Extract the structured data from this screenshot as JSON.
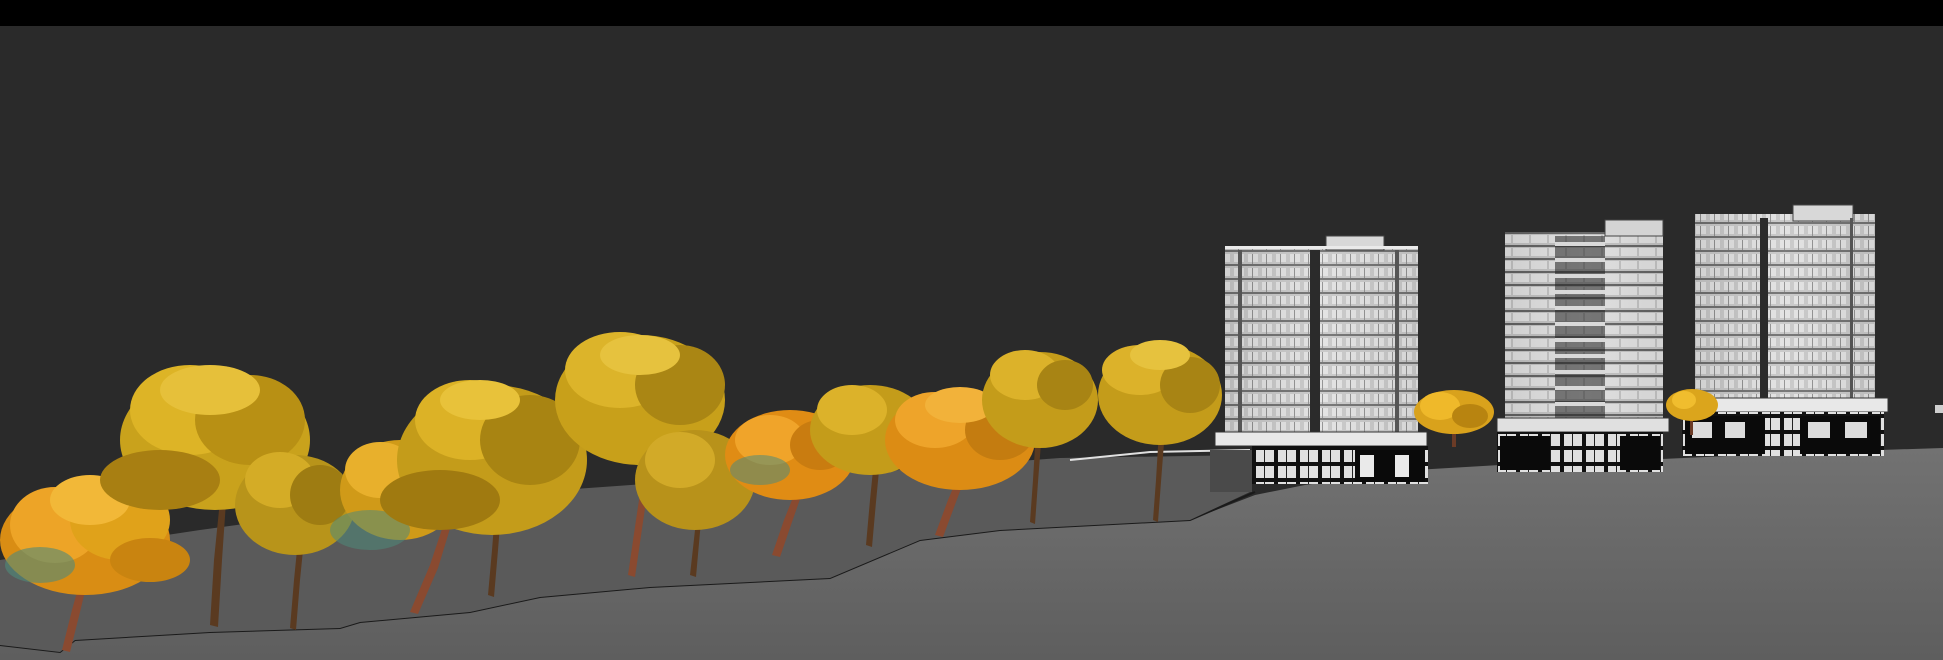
{
  "scene": {
    "colors": {
      "top_bar": "#000000",
      "sky": "#2a2a2a",
      "ground": "#6a6a6a",
      "terrace": "#595959",
      "building_face": "#c4c4c4",
      "building_shadow": "#3c3c3c",
      "foliage_orange": "#e89b1c",
      "foliage_yellow": "#d6b21a",
      "trunk": "#8a4a30"
    },
    "elements": {
      "trees": "flowering-yellow-trees",
      "buildings": "residential-towers"
    }
  }
}
